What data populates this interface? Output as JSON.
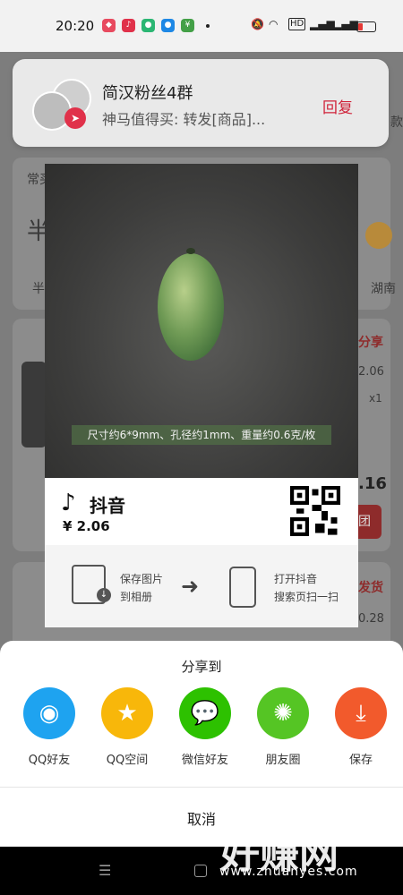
{
  "status_bar": {
    "time": "20:20",
    "signal_label": "HD",
    "battery_color": "#e53935"
  },
  "background_page": {
    "section_label": "常买",
    "shop_initial": "半",
    "tab_left": "半",
    "tab_right": "湖南",
    "right_peek": "款",
    "share_label": "分享",
    "price_1": "2.06",
    "qty_1": "x1",
    "total_1": ".16",
    "group_btn": "团",
    "ship_label": "发货",
    "price_2": "0.28"
  },
  "notification": {
    "title": "简汉粉丝4群",
    "body": "神马值得买: 转发[商品]...",
    "reply": "回复",
    "badge_color": "#e0314a"
  },
  "poster": {
    "caption": "尺寸约6*9mm、孔径约1mm、重量约0.6克/枚",
    "brand": "抖音",
    "price": "¥ 2.06",
    "save_line1": "保存图片",
    "save_line2": "到相册",
    "scan_line1": "打开抖音",
    "scan_line2": "搜索页扫一扫"
  },
  "share_sheet": {
    "title": "分享到",
    "targets": [
      {
        "label": "QQ好友",
        "icon": "qq-icon",
        "color": "#1ea3f0"
      },
      {
        "label": "QQ空间",
        "icon": "qzone-star-icon",
        "color": "#f8b70a"
      },
      {
        "label": "微信好友",
        "icon": "wechat-icon",
        "color": "#2dc100"
      },
      {
        "label": "朋友圈",
        "icon": "moments-shutter-icon",
        "color": "#55c524"
      },
      {
        "label": "保存",
        "icon": "download-icon",
        "color": "#f25a2c"
      }
    ],
    "cancel": "取消"
  },
  "watermark": {
    "text": "好赚网",
    "url": "www.zhuanyes.com"
  }
}
